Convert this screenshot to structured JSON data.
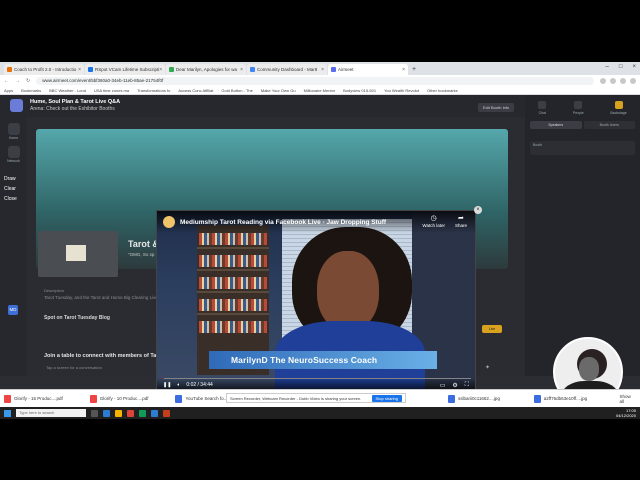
{
  "browser": {
    "tabs": [
      {
        "label": "Coach to Profit 2.0 - Introductio",
        "color": "#e8710a"
      },
      {
        "label": "RSpot VCam Lifetime Subscripti",
        "color": "#1a73e8"
      },
      {
        "label": "Dear Marilyn, Apologies for wa",
        "color": "#34a853"
      },
      {
        "label": "Community Dashboard - Mar8",
        "color": "#4285f4"
      },
      {
        "label": "Airmeet",
        "color": "#5b6cf0"
      }
    ],
    "new_tab": "+",
    "url": "www.airmeet.com/event/5bf360a0-34eb-11eb-85ae-21754f0f",
    "bookmarks": [
      "Apps",
      "Bookmarks",
      "BBC Weather - Lond",
      "USA time zones ma",
      "Transformations fo",
      "Access Conc Affiliat",
      "Gold Button - The",
      "Make Your Own Gu",
      "Millionaire Mentor",
      "Bodyview 015-501",
      "You Wealth Revolut",
      "Other bookmarks"
    ]
  },
  "app": {
    "title": "Hume, Soul Plan & Tarot Live Q&A",
    "subtitle": "Arena: Check out the Exhibitor Booths",
    "edit_booth": "Edit Booth Info",
    "rail": [
      "Home",
      "Network",
      "Sessions"
    ],
    "rail_draw": "Draw",
    "rail_clear": "Clear",
    "rail_close": "Close",
    "avatar": "MD",
    "tarot_title": "Tarot &",
    "tarot_sub": "\"OMG, So sp",
    "desc_heading": "Description",
    "desc": "Tarot Tuesday, and the Tarot and Hume Big Clearing Live Q&A… website link below. The Sessions and Readings are all free.",
    "spot_button": "Spot on Tarot Tuesday Blog",
    "show_more": "Show more info",
    "join_title": "Join a table to connect with members of Tarot & Oracle Card Reading",
    "join_sub": "Tap a screen for a conversation",
    "tag": "Live",
    "right_tabs": [
      "Chat",
      "People",
      "Backstage"
    ],
    "right_seg": [
      "Speakers",
      "Booth Users"
    ],
    "right_user": "Booth"
  },
  "video": {
    "title": "Mediumship Tarot Reading via Facebook Live - Jaw Dropping Stuff",
    "watch_later": "Watch later",
    "share": "Share",
    "lower_third": "MarilynD The NeuroSuccess Coach",
    "time": "0:02 / 34:44",
    "progress": 0.001
  },
  "downloads": [
    {
      "label": "Glorify - 15 Produc....pdf",
      "type": "pdf"
    },
    {
      "label": "Glorify - 10 Produc....pdf",
      "type": "pdf"
    },
    {
      "label": "YouTube Search fo....jpg",
      "type": "jpg"
    }
  ],
  "share_banner": {
    "text": "Screen Recorder, Webcam Recorder - Dubb Video is sharing your screen.",
    "stop": "Stop sharing"
  },
  "downloads_right": [
    {
      "label": "sslbarii0c11662....jpg",
      "type": "jpg"
    },
    {
      "label": "a2ff76db63e10ff....jpg",
      "type": "jpg"
    }
  ],
  "show_all": "Show all",
  "taskbar": {
    "search": "Type here to search",
    "time": "17:05",
    "date": "04/12/2020"
  },
  "recorder": [
    "stop",
    "cam",
    "expand",
    "pause",
    "more"
  ]
}
